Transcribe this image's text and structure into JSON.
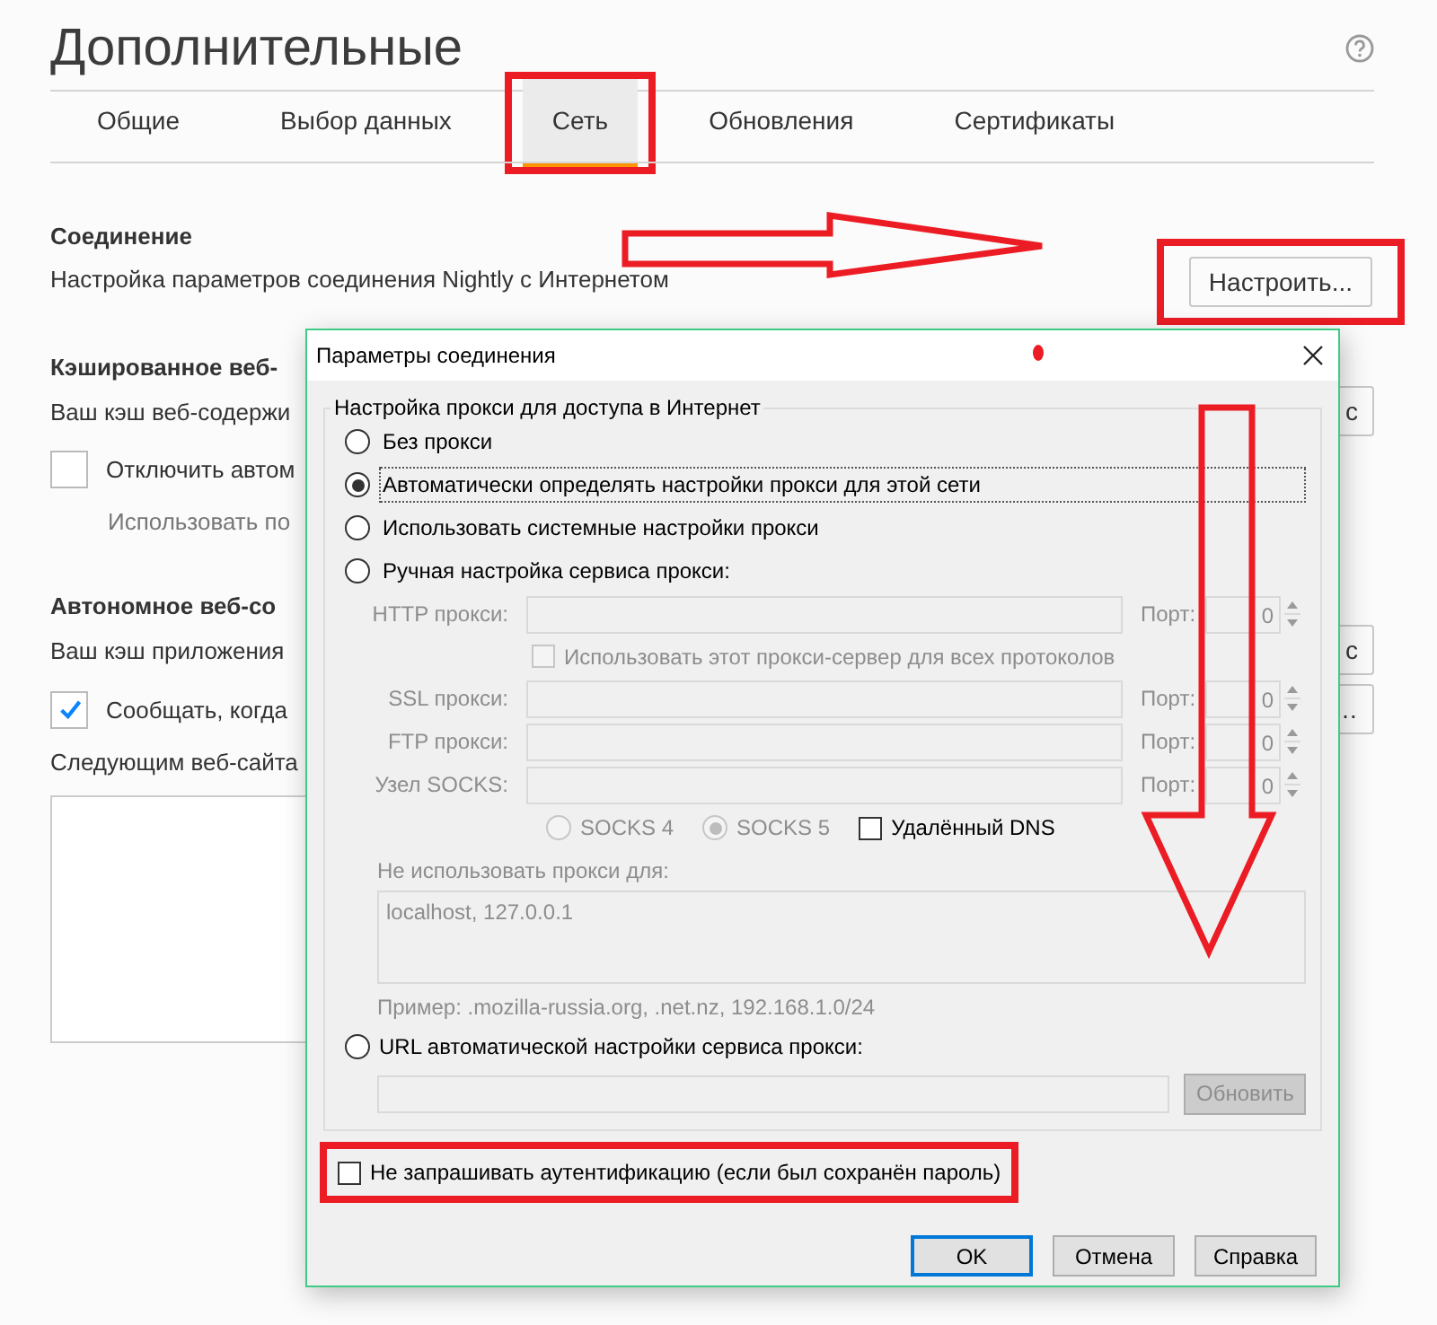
{
  "page": {
    "title": "Дополнительные"
  },
  "tabs": [
    {
      "label": "Общие",
      "selected": false,
      "highlighted": false
    },
    {
      "label": "Выбор данных",
      "selected": false,
      "highlighted": false
    },
    {
      "label": "Сеть",
      "selected": true,
      "highlighted": true
    },
    {
      "label": "Обновления",
      "selected": false,
      "highlighted": false
    },
    {
      "label": "Сертификаты",
      "selected": false,
      "highlighted": false
    }
  ],
  "connection": {
    "heading": "Соединение",
    "description": "Настройка параметров соединения Nightly с Интернетом",
    "button": {
      "label": "Настроить...",
      "highlighted": true
    }
  },
  "cache": {
    "heading": "Кэшированное веб-",
    "description": "Ваш кэш веб-содержи",
    "button_fragment": "с",
    "option": {
      "label": "Отключить автом",
      "checked": false
    },
    "note": "Использовать по"
  },
  "offline": {
    "heading": "Автономное веб-со",
    "description": "Ваш кэш приложения",
    "button_fragments": [
      "с",
      "…"
    ],
    "option": {
      "label": "Сообщать, когда",
      "checked": true
    },
    "list_label": "Следующим веб-сайта"
  },
  "dialog": {
    "title": "Параметры соединения",
    "legend": "Настройка прокси для доступа в Интернет",
    "modes": [
      {
        "label": "Без прокси",
        "selected": false,
        "focused": false
      },
      {
        "label": "Автоматически определять настройки прокси для этой сети",
        "selected": true,
        "focused": true
      },
      {
        "label": "Использовать системные настройки прокси",
        "selected": false,
        "focused": false
      },
      {
        "label": "Ручная настройка сервиса прокси:",
        "selected": false,
        "focused": false
      }
    ],
    "manual": {
      "disabled": true,
      "rows": [
        {
          "label": "HTTP прокси:",
          "port_label": "Порт:",
          "port": "0"
        },
        {
          "label": "SSL прокси:",
          "port_label": "Порт:",
          "port": "0"
        },
        {
          "label": "FTP прокси:",
          "port_label": "Порт:",
          "port": "0"
        },
        {
          "label": "Узел SOCKS:",
          "port_label": "Порт:",
          "port": "0"
        }
      ],
      "share": {
        "label": "Использовать этот прокси-сервер для всех протоколов",
        "checked": false
      },
      "socks_versions": [
        {
          "label": "SOCKS 4",
          "selected": false
        },
        {
          "label": "SOCKS 5",
          "selected": true
        }
      ],
      "remote_dns": {
        "label": "Удалённый DNS",
        "checked": false
      },
      "no_proxy_label": "Не использовать прокси для:",
      "no_proxy_value": "localhost, 127.0.0.1",
      "example": "Пример: .mozilla-russia.org, .net.nz, 192.168.1.0/24"
    },
    "auto_url": {
      "label": "URL автоматической настройки сервиса прокси:",
      "selected": false,
      "disabled": true,
      "button": "Обновить"
    },
    "auth": {
      "label": "Не запрашивать аутентификацию (если был сохранён пароль)",
      "checked": false,
      "highlighted": true
    },
    "buttons": [
      {
        "label": "OK",
        "default": true
      },
      {
        "label": "Отмена",
        "default": false
      },
      {
        "label": "Справка",
        "default": false
      }
    ]
  },
  "annotations": [
    {
      "kind": "arrow-right"
    },
    {
      "kind": "arrow-down"
    },
    {
      "kind": "dot"
    }
  ]
}
